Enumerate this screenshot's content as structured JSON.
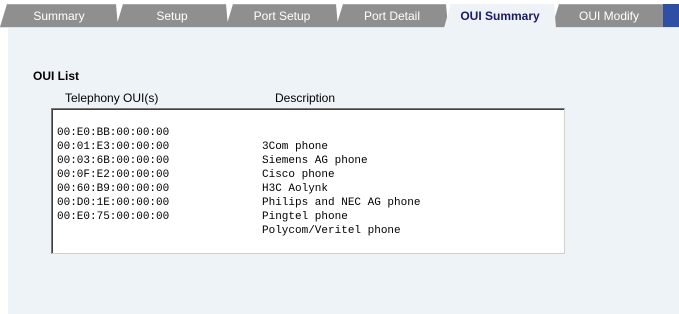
{
  "tabs": [
    {
      "label": "Summary",
      "active": false
    },
    {
      "label": "Setup",
      "active": false
    },
    {
      "label": "Port Setup",
      "active": false
    },
    {
      "label": "Port Detail",
      "active": false
    },
    {
      "label": "OUI Summary",
      "active": true
    },
    {
      "label": "OUI Modify",
      "active": false
    }
  ],
  "section": {
    "title": "OUI List"
  },
  "list": {
    "headers": {
      "oui": "Telephony OUI(s)",
      "description": "Description"
    },
    "rows": [
      {
        "oui": "00:E0:BB:00:00:00",
        "description": "3Com phone"
      },
      {
        "oui": "00:01:E3:00:00:00",
        "description": "Siemens AG phone"
      },
      {
        "oui": "00:03:6B:00:00:00",
        "description": "Cisco phone"
      },
      {
        "oui": "00:0F:E2:00:00:00",
        "description": "H3C Aolynk"
      },
      {
        "oui": "00:60:B9:00:00:00",
        "description": "Philips and NEC AG phone"
      },
      {
        "oui": "00:D0:1E:00:00:00",
        "description": "Pingtel phone"
      },
      {
        "oui": "00:E0:75:00:00:00",
        "description": "Polycom/Veritel phone"
      }
    ]
  },
  "colors": {
    "tab_inactive": "#8f8f8f",
    "tab_active_bg": "#eef3f8",
    "tab_active_text": "#1a1a66",
    "panel_bg": "#eef3f8",
    "edge_accent": "#2e4fa3"
  }
}
